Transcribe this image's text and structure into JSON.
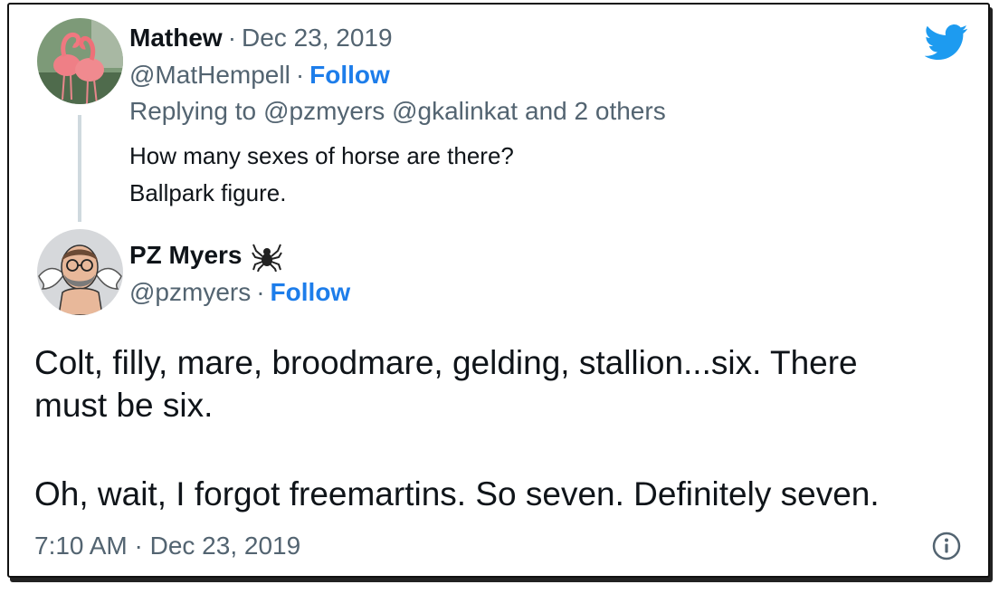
{
  "first_tweet": {
    "name": "Mathew",
    "dot": "·",
    "date": "Dec 23, 2019",
    "handle": "@MatHempell",
    "follow": "Follow",
    "replying_prefix": "Replying to",
    "replying_mentions": "@pzmyers @gkalinkat",
    "replying_suffix": "and 2 others",
    "text_line1": "How many sexes of horse are there?",
    "text_line2": "Ballpark figure."
  },
  "second_tweet": {
    "name": "PZ Myers",
    "name_emoji_icon": "spider-icon",
    "dot": "·",
    "handle": "@pzmyers",
    "follow": "Follow",
    "text_para1_line1": "Colt, filly, mare, broodmare, gelding, stallion...six. There",
    "text_para1_line2": "must be six.",
    "text_para2": "Oh, wait, I forgot freemartins. So seven. Definitely seven.",
    "timestamp": "7:10 AM · Dec 23, 2019"
  },
  "icons": {
    "logo": "twitter-bird-icon",
    "info": "info-icon"
  },
  "colors": {
    "link": "#1d7dea",
    "muted": "#536471",
    "text": "#0f1419",
    "twitter_blue": "#1d9bf0"
  }
}
